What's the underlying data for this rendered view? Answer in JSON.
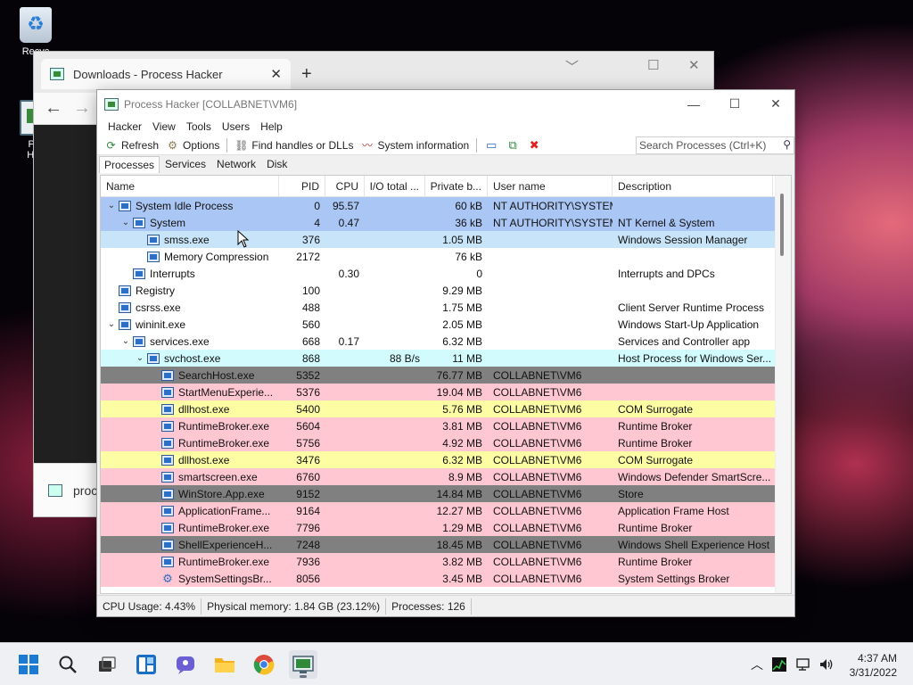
{
  "desktop": {
    "recycle_label": "Recyc",
    "ph_label_1": "Pro",
    "ph_label_2": "Hac"
  },
  "bg_window": {
    "tab_title": "Downloads - Process Hacker",
    "tab_close": "✕",
    "new_tab": "+",
    "bottom_text": "proc",
    "minimize": "﹀",
    "maximize": "☐",
    "close": "✕",
    "back": "←",
    "forward": "→"
  },
  "ph": {
    "title": "Process Hacker [COLLABNET\\VM6]",
    "win_min": "—",
    "win_max": "☐",
    "win_close": "✕",
    "menu": [
      "Hacker",
      "View",
      "Tools",
      "Users",
      "Help"
    ],
    "toolbar": {
      "refresh": "Refresh",
      "options": "Options",
      "find_handles": "Find handles or DLLs",
      "system_info": "System information"
    },
    "search": {
      "placeholder": "Search Processes (Ctrl+K)"
    },
    "tabs": [
      "Processes",
      "Services",
      "Network",
      "Disk"
    ],
    "columns": {
      "name": "Name",
      "pid": "PID",
      "cpu": "CPU",
      "io": "I/O total ...",
      "private": "Private b...",
      "user": "User name",
      "desc": "Description"
    },
    "processes": [
      {
        "name": "System Idle Process",
        "pid": "0",
        "cpu": "95.57",
        "io": "",
        "private": "60 kB",
        "user": "NT AUTHORITY\\SYSTEM",
        "desc": "",
        "depth": 0,
        "chev": "⌄",
        "color": "blue",
        "icon": "process"
      },
      {
        "name": "System",
        "pid": "4",
        "cpu": "0.47",
        "io": "",
        "private": "36 kB",
        "user": "NT AUTHORITY\\SYSTEM",
        "desc": "NT Kernel & System",
        "depth": 1,
        "chev": "⌄",
        "color": "blue",
        "icon": "process"
      },
      {
        "name": "smss.exe",
        "pid": "376",
        "cpu": "",
        "io": "",
        "private": "1.05 MB",
        "user": "",
        "desc": "Windows Session Manager",
        "depth": 2,
        "chev": "",
        "color": "lightblue",
        "icon": "process"
      },
      {
        "name": "Memory Compression",
        "pid": "2172",
        "cpu": "",
        "io": "",
        "private": "76 kB",
        "user": "",
        "desc": "",
        "depth": 2,
        "chev": "",
        "color": "white",
        "icon": "process"
      },
      {
        "name": "Interrupts",
        "pid": "",
        "cpu": "0.30",
        "io": "",
        "private": "0",
        "user": "",
        "desc": "Interrupts and DPCs",
        "depth": 1,
        "chev": "",
        "color": "white",
        "icon": "process"
      },
      {
        "name": "Registry",
        "pid": "100",
        "cpu": "",
        "io": "",
        "private": "9.29 MB",
        "user": "",
        "desc": "",
        "depth": 0,
        "chev": "",
        "color": "white",
        "icon": "process"
      },
      {
        "name": "csrss.exe",
        "pid": "488",
        "cpu": "",
        "io": "",
        "private": "1.75 MB",
        "user": "",
        "desc": "Client Server Runtime Process",
        "depth": 0,
        "chev": "",
        "color": "white",
        "icon": "process"
      },
      {
        "name": "wininit.exe",
        "pid": "560",
        "cpu": "",
        "io": "",
        "private": "2.05 MB",
        "user": "",
        "desc": "Windows Start-Up Application",
        "depth": 0,
        "chev": "⌄",
        "color": "white",
        "icon": "process"
      },
      {
        "name": "services.exe",
        "pid": "668",
        "cpu": "0.17",
        "io": "",
        "private": "6.32 MB",
        "user": "",
        "desc": "Services and Controller app",
        "depth": 1,
        "chev": "⌄",
        "color": "white",
        "icon": "process"
      },
      {
        "name": "svchost.exe",
        "pid": "868",
        "cpu": "",
        "io": "88 B/s",
        "private": "11 MB",
        "user": "",
        "desc": "Host Process for Windows Ser...",
        "depth": 2,
        "chev": "⌄",
        "color": "cyan",
        "icon": "process"
      },
      {
        "name": "SearchHost.exe",
        "pid": "5352",
        "cpu": "",
        "io": "",
        "private": "76.77 MB",
        "user": "COLLABNET\\VM6",
        "desc": "",
        "depth": 3,
        "chev": "",
        "color": "gray",
        "icon": "process"
      },
      {
        "name": "StartMenuExperie...",
        "pid": "5376",
        "cpu": "",
        "io": "",
        "private": "19.04 MB",
        "user": "COLLABNET\\VM6",
        "desc": "",
        "depth": 3,
        "chev": "",
        "color": "pink",
        "icon": "process"
      },
      {
        "name": "dllhost.exe",
        "pid": "5400",
        "cpu": "",
        "io": "",
        "private": "5.76 MB",
        "user": "COLLABNET\\VM6",
        "desc": "COM Surrogate",
        "depth": 3,
        "chev": "",
        "color": "yellow",
        "icon": "process"
      },
      {
        "name": "RuntimeBroker.exe",
        "pid": "5604",
        "cpu": "",
        "io": "",
        "private": "3.81 MB",
        "user": "COLLABNET\\VM6",
        "desc": "Runtime Broker",
        "depth": 3,
        "chev": "",
        "color": "pink",
        "icon": "process"
      },
      {
        "name": "RuntimeBroker.exe",
        "pid": "5756",
        "cpu": "",
        "io": "",
        "private": "4.92 MB",
        "user": "COLLABNET\\VM6",
        "desc": "Runtime Broker",
        "depth": 3,
        "chev": "",
        "color": "pink",
        "icon": "process"
      },
      {
        "name": "dllhost.exe",
        "pid": "3476",
        "cpu": "",
        "io": "",
        "private": "6.32 MB",
        "user": "COLLABNET\\VM6",
        "desc": "COM Surrogate",
        "depth": 3,
        "chev": "",
        "color": "yellow",
        "icon": "process"
      },
      {
        "name": "smartscreen.exe",
        "pid": "6760",
        "cpu": "",
        "io": "",
        "private": "8.9 MB",
        "user": "COLLABNET\\VM6",
        "desc": "Windows Defender SmartScre...",
        "depth": 3,
        "chev": "",
        "color": "pink",
        "icon": "process"
      },
      {
        "name": "WinStore.App.exe",
        "pid": "9152",
        "cpu": "",
        "io": "",
        "private": "14.84 MB",
        "user": "COLLABNET\\VM6",
        "desc": "Store",
        "depth": 3,
        "chev": "",
        "color": "gray",
        "icon": "process"
      },
      {
        "name": "ApplicationFrame...",
        "pid": "9164",
        "cpu": "",
        "io": "",
        "private": "12.27 MB",
        "user": "COLLABNET\\VM6",
        "desc": "Application Frame Host",
        "depth": 3,
        "chev": "",
        "color": "pink",
        "icon": "process"
      },
      {
        "name": "RuntimeBroker.exe",
        "pid": "7796",
        "cpu": "",
        "io": "",
        "private": "1.29 MB",
        "user": "COLLABNET\\VM6",
        "desc": "Runtime Broker",
        "depth": 3,
        "chev": "",
        "color": "pink",
        "icon": "process"
      },
      {
        "name": "ShellExperienceH...",
        "pid": "7248",
        "cpu": "",
        "io": "",
        "private": "18.45 MB",
        "user": "COLLABNET\\VM6",
        "desc": "Windows Shell Experience Host",
        "depth": 3,
        "chev": "",
        "color": "gray",
        "icon": "process"
      },
      {
        "name": "RuntimeBroker.exe",
        "pid": "7936",
        "cpu": "",
        "io": "",
        "private": "3.82 MB",
        "user": "COLLABNET\\VM6",
        "desc": "Runtime Broker",
        "depth": 3,
        "chev": "",
        "color": "pink",
        "icon": "process"
      },
      {
        "name": "SystemSettingsBr...",
        "pid": "8056",
        "cpu": "",
        "io": "",
        "private": "3.45 MB",
        "user": "COLLABNET\\VM6",
        "desc": "System Settings Broker",
        "depth": 3,
        "chev": "",
        "color": "pink",
        "icon": "gear"
      }
    ],
    "status": {
      "cpu": "CPU Usage: 4.43%",
      "memory": "Physical memory: 1.84 GB (23.12%)",
      "processes": "Processes: 126"
    }
  },
  "taskbar": {
    "time": "4:37 AM",
    "date": "3/31/2022",
    "chevron": "︿"
  },
  "colors": {
    "blue": "#aac6f4",
    "lightblue": "#c8e4f8",
    "cyan": "#d1fbfd",
    "gray": "#808080",
    "pink": "#ffc7d2",
    "yellow": "#fdfda4",
    "white": "#ffffff"
  }
}
